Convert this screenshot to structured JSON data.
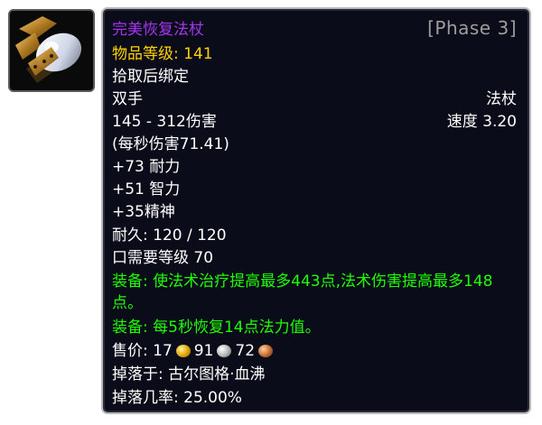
{
  "item": {
    "name": "完美恢复法杖",
    "phase": "[Phase 3]",
    "item_level_label": "物品等级: ",
    "item_level_value": "141",
    "bind": "拾取后绑定",
    "hand": "双手",
    "type": "法杖",
    "damage": "145 - 312伤害",
    "speed": "速度 3.20",
    "dps": "(每秒伤害71.41)",
    "stats": [
      "+73 耐力",
      "+51 智力",
      "+35精神"
    ],
    "durability": "耐久: 120 / 120",
    "required_level": "口需要等级 70",
    "equip1": "装备: 使法术治疗提高最多443点,法术伤害提高最多148点。",
    "equip2": "装备: 每5秒恢复14点法力值。",
    "sell_label": "售价: ",
    "price": {
      "gold": "17",
      "silver": "91",
      "copper": "72"
    },
    "drop_from": "掉落于: 古尔图格·血沸",
    "drop_rate": "掉落几率: 25.00%"
  },
  "colors": {
    "epic": "#a335ee",
    "yellow": "#ffd200",
    "green": "#1eff00",
    "phase_grey": "#9d9d9d",
    "tooltip_bg": "#0b0c1a",
    "border": "#b9b9b9"
  },
  "icons": {
    "item": "staff-item-icon",
    "gold": "gold-coin-icon",
    "silver": "silver-coin-icon",
    "copper": "copper-coin-icon"
  }
}
